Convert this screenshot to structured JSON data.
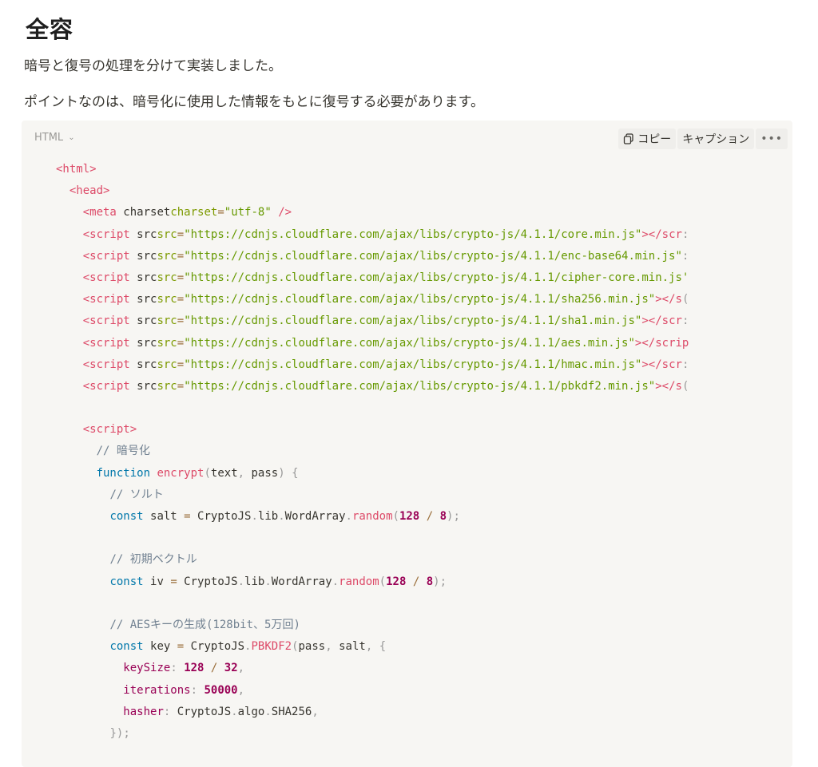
{
  "heading": "全容",
  "paragraphs": [
    "暗号と復号の処理を分けて実装しました。",
    "ポイントなのは、暗号化に使用した情報をもとに復号する必要があります。"
  ],
  "codeblock": {
    "language": "HTML",
    "copy_label": "コピー",
    "caption_label": "キャプション",
    "more_label": "•••",
    "lines": [
      "<html>",
      "  <head>",
      "    <meta charset=\"utf-8\" />",
      "    <script src=\"https://cdnjs.cloudflare.com/ajax/libs/crypto-js/4.1.1/core.min.js\"></scr:",
      "    <script src=\"https://cdnjs.cloudflare.com/ajax/libs/crypto-js/4.1.1/enc-base64.min.js\":",
      "    <script src=\"https://cdnjs.cloudflare.com/ajax/libs/crypto-js/4.1.1/cipher-core.min.js'",
      "    <script src=\"https://cdnjs.cloudflare.com/ajax/libs/crypto-js/4.1.1/sha256.min.js\"></s(",
      "    <script src=\"https://cdnjs.cloudflare.com/ajax/libs/crypto-js/4.1.1/sha1.min.js\"></scr:",
      "    <script src=\"https://cdnjs.cloudflare.com/ajax/libs/crypto-js/4.1.1/aes.min.js\"></scrip",
      "    <script src=\"https://cdnjs.cloudflare.com/ajax/libs/crypto-js/4.1.1/hmac.min.js\"></scr:",
      "    <script src=\"https://cdnjs.cloudflare.com/ajax/libs/crypto-js/4.1.1/pbkdf2.min.js\"></s(",
      "",
      "    <script>",
      "      // 暗号化",
      "      function encrypt(text, pass) {",
      "        // ソルト",
      "        const salt = CryptoJS.lib.WordArray.random(128 / 8);",
      "",
      "        // 初期ベクトル",
      "        const iv = CryptoJS.lib.WordArray.random(128 / 8);",
      "",
      "        // AESキーの生成(128bit、5万回)",
      "        const key = CryptoJS.PBKDF2(pass, salt, {",
      "          keySize: 128 / 32,",
      "          iterations: 50000,",
      "          hasher: CryptoJS.algo.SHA256,",
      "        });"
    ]
  }
}
